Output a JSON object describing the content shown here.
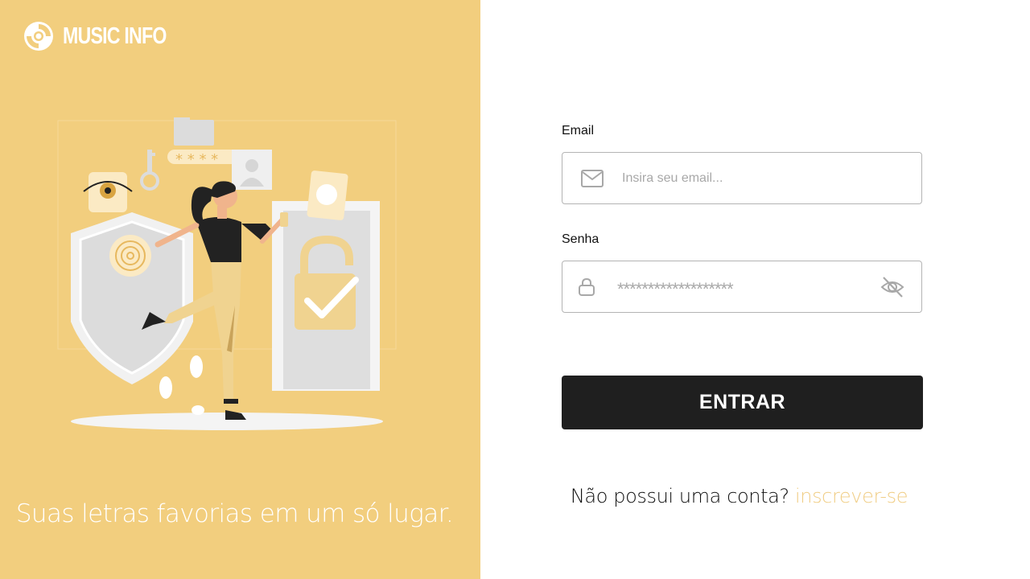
{
  "brand": {
    "name": "MUSIC INFO",
    "icon": "vinyl-disc-icon",
    "color": "#ffffff"
  },
  "left_panel": {
    "background": "#f2ce7e",
    "tagline": "Suas letras favorias em um só lugar.",
    "illustration": "woman-security-shield-padlock-illustration"
  },
  "form": {
    "email": {
      "label": "Email",
      "placeholder": "Insira seu email...",
      "value": "",
      "icon": "envelope-icon"
    },
    "password": {
      "label": "Senha",
      "value": "*******************",
      "icon": "lock-icon",
      "toggle_icon": "eye-off-icon"
    },
    "submit_label": "ENTRAR",
    "signup_prompt": "Não possui uma conta?",
    "signup_link": "inscrever-se"
  },
  "colors": {
    "accent": "#f2ce7e",
    "button": "#1f1f1f",
    "link": "#f0cd84",
    "border": "#b4b4b4"
  }
}
